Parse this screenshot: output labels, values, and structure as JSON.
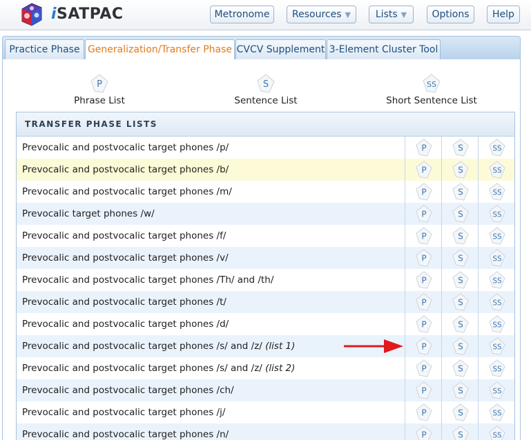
{
  "header": {
    "brand_prefix": "i",
    "brand_name": "SATPAC",
    "buttons": {
      "metronome": "Metronome",
      "resources": "Resources",
      "lists": "Lists",
      "options": "Options",
      "help": "Help"
    }
  },
  "tabs": [
    {
      "label": "Practice Phase"
    },
    {
      "label": "Generalization/Transfer Phase"
    },
    {
      "label": "CVCV Supplement"
    },
    {
      "label": "3-Element Cluster Tool"
    }
  ],
  "active_tab": "Generalization/Transfer Phase",
  "top_lists": {
    "phrase": "Phrase List",
    "sentence": "Sentence List",
    "short_sentence": "Short Sentence List"
  },
  "table": {
    "heading": "TRANSFER PHASE LISTS",
    "rows": [
      {
        "label": "Prevocalic and postvocalic target phones /p/",
        "note": ""
      },
      {
        "label": "Prevocalic and postvocalic target phones /b/",
        "note": ""
      },
      {
        "label": "Prevocalic and postvocalic target phones /m/",
        "note": ""
      },
      {
        "label": "Prevocalic target phones /w/",
        "note": ""
      },
      {
        "label": "Prevocalic and postvocalic target phones /f/",
        "note": ""
      },
      {
        "label": "Prevocalic and postvocalic target phones /v/",
        "note": ""
      },
      {
        "label": "Prevocalic and postvocalic target phones /Th/ and /th/",
        "note": ""
      },
      {
        "label": "Prevocalic and postvocalic target phones /t/",
        "note": ""
      },
      {
        "label": "Prevocalic and postvocalic target phones /d/",
        "note": ""
      },
      {
        "label": "Prevocalic and postvocalic target phones /s/ and /z/",
        "note": "(list 1)"
      },
      {
        "label": "Prevocalic and postvocalic target phones /s/ and /z/",
        "note": "(list 2)"
      },
      {
        "label": "Prevocalic and postvocalic target phones /ch/",
        "note": ""
      },
      {
        "label": "Prevocalic and postvocalic target phones /j/",
        "note": ""
      },
      {
        "label": "Prevocalic and postvocalic target phones /n/",
        "note": ""
      }
    ]
  },
  "icons": {
    "phrase_letter": "P",
    "sentence_letter": "S",
    "short_sentence_letter": "SS"
  },
  "colors": {
    "accent_tab": "#e07b1a",
    "link_blue": "#1f4f80",
    "highlight_row": "#fdfbd7",
    "alt_row": "#eaf3fc",
    "arrow_red": "#e0191b"
  }
}
